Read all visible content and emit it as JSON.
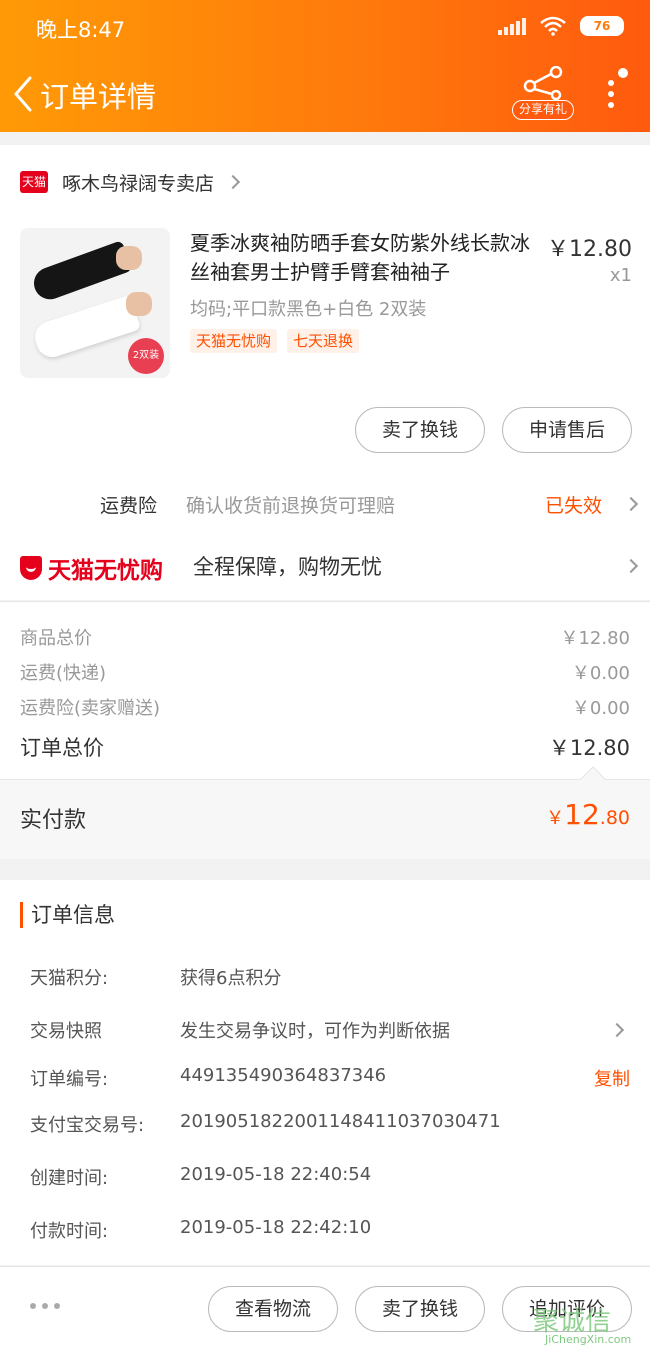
{
  "status_bar": {
    "time": "晚上8:47",
    "battery": "76"
  },
  "nav": {
    "title": "订单详情",
    "share_label": "分享有礼"
  },
  "shop": {
    "badge": "天猫",
    "name": "啄木鸟禄阔专卖店"
  },
  "product": {
    "title": "夏季冰爽袖防晒手套女防紫外线长款冰丝袖套男士护臂手臂套袖袖子",
    "spec": "均码;平口款黑色+白色 2双装",
    "tags": [
      "天猫无忧购",
      "七天退换"
    ],
    "price": "￥12.80",
    "qty": "x1",
    "thumb_badge": "2双装"
  },
  "product_actions": {
    "sell": "卖了换钱",
    "aftersale": "申请售后"
  },
  "freight_insurance": {
    "label": "运费险",
    "desc": "确认收货前退换货可理赔",
    "status": "已失效"
  },
  "worry_free": {
    "name": "天猫无忧购",
    "desc": "全程保障，购物无忧"
  },
  "prices": {
    "rows": [
      {
        "label": "商品总价",
        "value": "￥12.80"
      },
      {
        "label": "运费(快递)",
        "value": "￥0.00"
      },
      {
        "label": "运费险(卖家赠送)",
        "value": "￥0.00"
      }
    ],
    "total_label": "订单总价",
    "total_value": "￥12.80"
  },
  "paid": {
    "label": "实付款",
    "currency": "￥",
    "int": "12",
    "dec": ".80"
  },
  "order_info": {
    "title": "订单信息",
    "rows": [
      {
        "label": "天猫积分:",
        "value": "获得6点积分"
      },
      {
        "label": "交易快照",
        "value": "发生交易争议时，可作为判断依据"
      },
      {
        "label": "订单编号:",
        "value": "449135490364837346",
        "action": "复制"
      },
      {
        "label": "支付宝交易号:",
        "value": "2019051822001148411037030471"
      },
      {
        "label": "创建时间:",
        "value": "2019-05-18 22:40:54"
      },
      {
        "label": "付款时间:",
        "value": "2019-05-18 22:42:10"
      }
    ]
  },
  "bottom_actions": {
    "logistics": "查看物流",
    "sell": "卖了换钱",
    "review": "追加评价"
  },
  "watermark": {
    "main": "聚诚信",
    "sub": "JiChengXin.com"
  },
  "colors": {
    "accent": "#ff5000",
    "header_start": "#ff9a06",
    "header_end": "#ff5a0e",
    "tmall_red": "#e5001c"
  }
}
